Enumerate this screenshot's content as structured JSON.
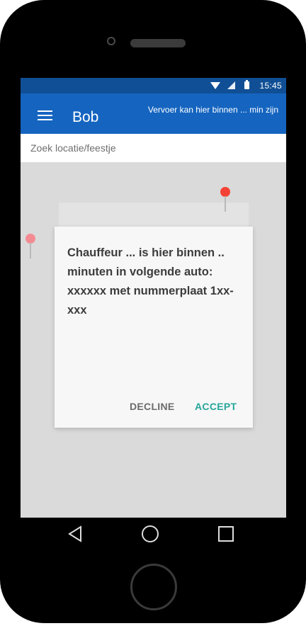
{
  "statusbar": {
    "time": "15:45",
    "icons": [
      "wifi-icon",
      "signal-icon",
      "battery-icon"
    ]
  },
  "appbar": {
    "title": "Bob",
    "eta_text": "Vervoer kan hier binnen ... min zijn",
    "menu_icon": "menu-icon"
  },
  "search": {
    "placeholder": "Zoek locatie/feestje"
  },
  "map": {
    "pins": [
      "map-pin-red",
      "map-pin-pink"
    ],
    "colors": {
      "pin_primary": "#f44336",
      "pin_secondary": "#f48b93"
    }
  },
  "dialog": {
    "message": "Chauffeur ... is hier binnen .. minuten in volgende auto: xxxxxx met nummerplaat 1xx-xxx",
    "decline_label": "DECLINE",
    "accept_label": "ACCEPT"
  },
  "navbar": {
    "icons": [
      "back-icon",
      "home-icon",
      "recents-icon"
    ]
  },
  "colors": {
    "appbar": "#1565c0",
    "statusbar": "#104f95",
    "accent": "#26a69a"
  }
}
